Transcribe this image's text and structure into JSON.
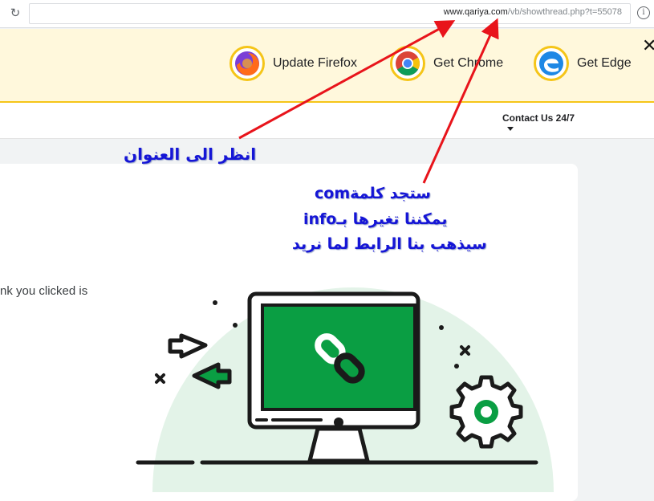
{
  "browser": {
    "url_domain": "www.qariya.com",
    "url_path": "/vb/showthread.php?t=55078",
    "reload_icon": "reload-icon",
    "info_icon": "info-icon"
  },
  "banner": {
    "items": [
      {
        "label": "Update Firefox",
        "icon": "firefox-icon"
      },
      {
        "label": "Get Chrome",
        "icon": "chrome-icon"
      },
      {
        "label": "Get Edge",
        "icon": "edge-icon"
      }
    ],
    "close_label": "✕"
  },
  "nav": {
    "contact_label": "Contact Us 24/7"
  },
  "main": {
    "body_text": "nk you clicked is"
  },
  "annotations": {
    "line1": "انظر الى العنوان",
    "line2": "ستجد كلمةcom",
    "line3": "يمكننا تغيرها بـinfo",
    "line4": "سيذهب بنا الرابط لما نريد"
  },
  "colors": {
    "banner_bg": "#fff8dc",
    "banner_accent": "#f5c518",
    "arrow": "#e8141b",
    "annotation_text": "#1515d6",
    "monitor_screen": "#0a9e43",
    "illustration_bg": "#e3f3e8"
  }
}
